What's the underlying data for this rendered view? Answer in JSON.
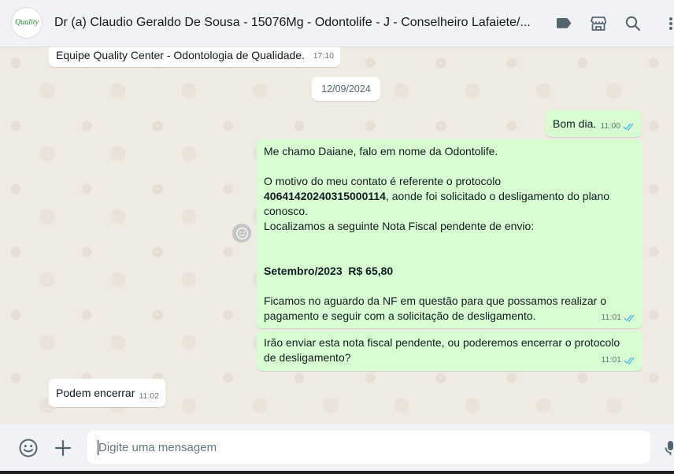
{
  "header": {
    "title": "Dr (a) Claudio Geraldo De Sousa - 15076Mg - Odontolife - J - Conselheiro Lafaiete/...",
    "avatar_text": "Quality",
    "icons": [
      "label-icon",
      "store-icon",
      "search-icon",
      "menu-icon"
    ]
  },
  "messages": [
    {
      "direction": "in",
      "text": "Equipe Quality Center - Odontologia de Qualidade.",
      "time": "17:10"
    },
    {
      "direction": "date",
      "text": "12/09/2024"
    },
    {
      "direction": "out",
      "text": "Bom dia.",
      "time": "11:00",
      "status": "read"
    },
    {
      "direction": "out",
      "lines": {
        "l1": "Me chamo Daiane, falo em nome da Odontolife.",
        "l2": "O motivo do meu contato é referente o protocolo",
        "protocol": "40641420240315000114",
        "l3": ", aonde foi solicitado o desligamento do plano",
        "l4": "conosco.",
        "l5": "Localizamos a seguinte Nota Fiscal pendente de envio:",
        "invoice": "Setembro/2023  R$ 65,80",
        "l6": "Ficamos no aguardo da NF em questão para que possamos realizar o pagamento e seguir com a solicitação de desligamento."
      },
      "time": "11:01",
      "status": "read"
    },
    {
      "direction": "out",
      "text": "Irão enviar esta nota fiscal pendente, ou poderemos encerrar o protocolo de desligamento?",
      "time": "11:01",
      "status": "read"
    },
    {
      "direction": "in",
      "text": "Podem encerrar",
      "time": "11:02"
    }
  ],
  "composer": {
    "placeholder": "Digite uma mensagem",
    "icons": [
      "emoji-icon",
      "plus-icon",
      "microphone-icon"
    ]
  },
  "colors": {
    "outgoing_bubble": "#d9fdd3",
    "incoming_bubble": "#ffffff",
    "read_ticks": "#53bdeb",
    "header_bg": "#f0f2f5",
    "chat_bg": "#efeae2"
  }
}
